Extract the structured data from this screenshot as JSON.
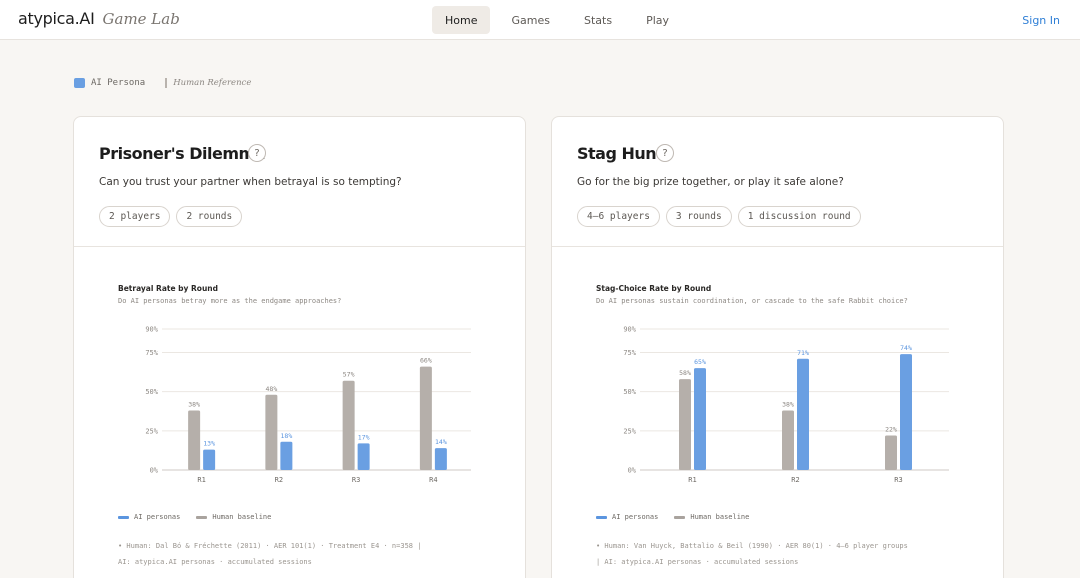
{
  "header": {
    "brand_name": "atypica.AI",
    "brand_sub": "Game Lab",
    "nav": [
      "Home",
      "Games",
      "Stats",
      "Play"
    ],
    "active_nav": "Home",
    "signin": "Sign In"
  },
  "legend_top": {
    "ai": "AI Persona",
    "human": "Human Reference"
  },
  "colors": {
    "ai": "#6a9fe2",
    "human": "#b5afaa",
    "ai_label": "#5b95df",
    "human_label": "#8a8580"
  },
  "cards": [
    {
      "title": "Prisoner's Dilemma",
      "help": "?",
      "description": "Can you trust your partner when betrayal is so tempting?",
      "chips": [
        "2 players",
        "2 rounds"
      ],
      "chart_title": "Betrayal Rate by Round",
      "chart_subtitle": "Do AI personas betray more as the endgame approaches?",
      "legend": [
        "AI personas",
        "Human baseline"
      ],
      "source_line1": "• Human: Dal Bó & Fréchette (2011) · AER 101(1) · Treatment E4 · n=358 |",
      "source_line2": "AI: atypica.AI personas · accumulated sessions"
    },
    {
      "title": "Stag Hunt",
      "help": "?",
      "description": "Go for the big prize together, or play it safe alone?",
      "chips": [
        "4–6 players",
        "3 rounds",
        "1 discussion round"
      ],
      "chart_title": "Stag-Choice Rate by Round",
      "chart_subtitle": "Do AI personas sustain coordination, or cascade to the safe Rabbit choice?",
      "legend": [
        "AI personas",
        "Human baseline"
      ],
      "source_line1": "• Human: Van Huyck, Battalio & Beil (1990) · AER 80(1) · 4–6 player groups",
      "source_line2": "| AI: atypica.AI personas · accumulated sessions"
    }
  ],
  "chart_data": [
    {
      "type": "bar",
      "title": "Betrayal Rate by Round",
      "categories": [
        "R1",
        "R2",
        "R3",
        "R4"
      ],
      "y_ticks": [
        "0%",
        "25%",
        "50%",
        "75%",
        "90%"
      ],
      "tick_values": [
        0,
        25,
        50,
        75,
        90
      ],
      "ylim": [
        0,
        90
      ],
      "series": [
        {
          "name": "Human baseline",
          "values": [
            38,
            48,
            57,
            66
          ]
        },
        {
          "name": "AI personas",
          "values": [
            13,
            18,
            17,
            14
          ]
        }
      ]
    },
    {
      "type": "bar",
      "title": "Stag-Choice Rate by Round",
      "categories": [
        "R1",
        "R2",
        "R3"
      ],
      "y_ticks": [
        "0%",
        "25%",
        "50%",
        "75%",
        "90%"
      ],
      "tick_values": [
        0,
        25,
        50,
        75,
        90
      ],
      "ylim": [
        0,
        90
      ],
      "series": [
        {
          "name": "Human baseline",
          "values": [
            58,
            38,
            22
          ]
        },
        {
          "name": "AI personas",
          "values": [
            65,
            71,
            74
          ]
        }
      ]
    }
  ]
}
